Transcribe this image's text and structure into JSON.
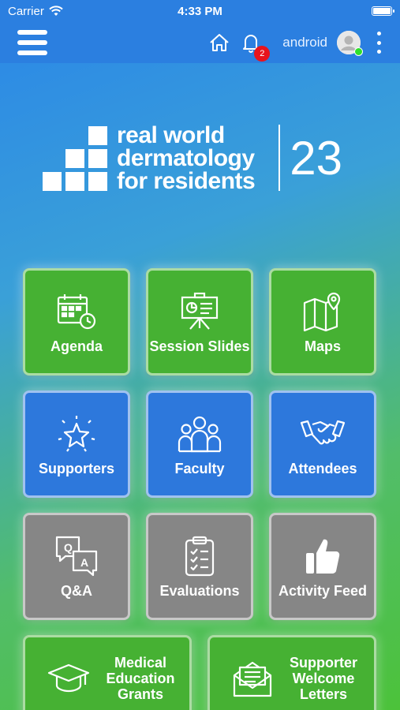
{
  "status_bar": {
    "carrier": "Carrier",
    "time": "4:33 PM"
  },
  "app_bar": {
    "username": "android",
    "notification_count": "2"
  },
  "logo": {
    "line1": "real world",
    "line2": "dermatology",
    "line3": "for residents",
    "year": "23"
  },
  "tiles": [
    {
      "label": "Agenda",
      "icon": "calendar-icon",
      "color": "#46b133"
    },
    {
      "label": "Session Slides",
      "icon": "presentation-icon",
      "color": "#46b133"
    },
    {
      "label": "Maps",
      "icon": "map-icon",
      "color": "#46b133"
    },
    {
      "label": "Supporters",
      "icon": "star-icon",
      "color": "#2d78dc"
    },
    {
      "label": "Faculty",
      "icon": "group-icon",
      "color": "#2d78dc"
    },
    {
      "label": "Attendees",
      "icon": "handshake-icon",
      "color": "#2d78dc"
    },
    {
      "label": "Q&A",
      "icon": "chat-icon",
      "color": "#868686"
    },
    {
      "label": "Evaluations",
      "icon": "clipboard-icon",
      "color": "#868686"
    },
    {
      "label": "Activity Feed",
      "icon": "thumbs-up-icon",
      "color": "#868686"
    },
    {
      "label": "Medical Education Grants",
      "icon": "graduation-cap-icon",
      "color": "#46b133"
    },
    {
      "label": "Supporter Welcome Letters",
      "icon": "envelope-icon",
      "color": "#46b133"
    }
  ]
}
